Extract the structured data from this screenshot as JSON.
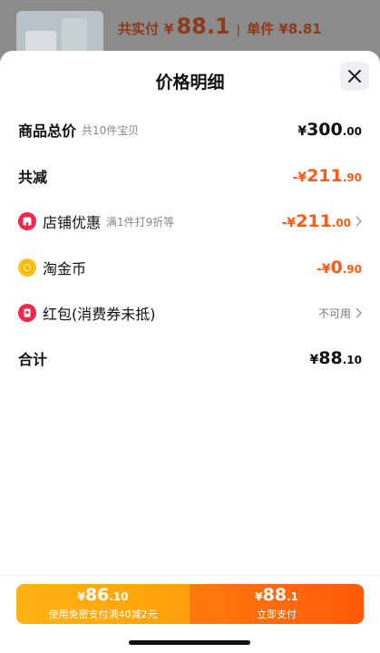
{
  "background": {
    "total_label": "共实付",
    "currency": "¥",
    "price": "88.1",
    "separator": "|",
    "unit_price": "单件 ¥8.81"
  },
  "sheet": {
    "title": "价格明细"
  },
  "rows": {
    "goods_total": {
      "label": "商品总价",
      "sub": "共10件宝贝",
      "pre": "¥",
      "int": "300",
      "dec": ".00"
    },
    "total_reduce": {
      "label": "共减",
      "pre": "-¥",
      "int": "211",
      "dec": ".90"
    },
    "store_discount": {
      "label": "店铺优惠",
      "sub": "满1件打9折等",
      "pre": "-¥",
      "int": "211",
      "dec": ".00"
    },
    "taojinbi": {
      "label": "淘金币",
      "pre": "-¥",
      "int": "0",
      "dec": ".90"
    },
    "red_packet": {
      "label": "红包(消费券未抵)",
      "status": "不可用"
    },
    "sum": {
      "label": "合计",
      "pre": "¥",
      "int": "88",
      "dec": ".10"
    }
  },
  "bottom": {
    "left": {
      "pre": "¥",
      "int": "86",
      "dec": ".10",
      "sub": "使用免密支付满40减2元"
    },
    "right": {
      "pre": "¥",
      "int": "88",
      "dec": ".1",
      "sub": "立即支付"
    }
  },
  "colors": {
    "accent_orange": "#ff5a16",
    "pay_left": "#ffa00a",
    "pay_right": "#ff5a0a"
  },
  "icons": [
    "close-icon",
    "store-icon",
    "coin-icon",
    "red-packet-icon",
    "chevron-right-icon"
  ]
}
